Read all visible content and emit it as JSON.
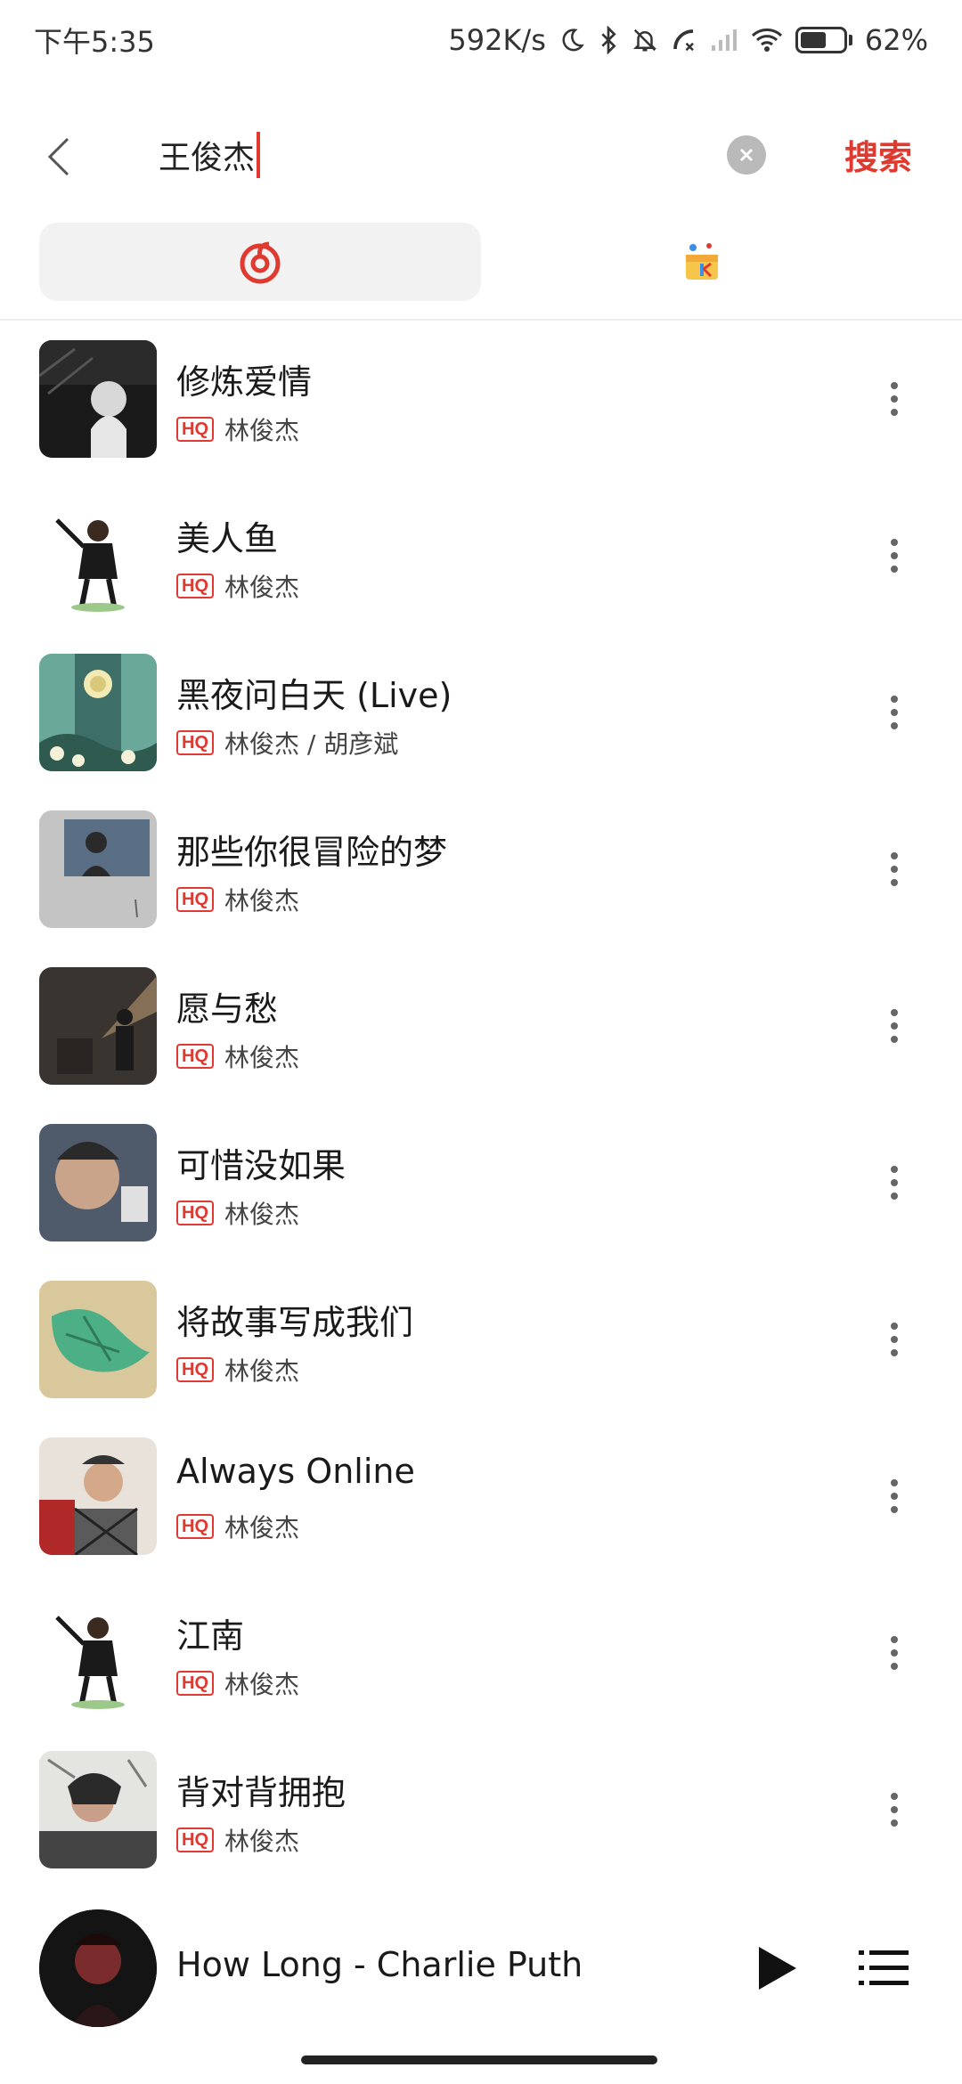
{
  "status_bar": {
    "time": "下午5:35",
    "net_speed": "592K/s",
    "battery": "62%",
    "battery_level": 0.62
  },
  "search": {
    "query": "王俊杰",
    "search_button": "搜索"
  },
  "source_tabs": [
    {
      "name": "netease-music",
      "active": true
    },
    {
      "name": "kge-karaoke",
      "active": false
    }
  ],
  "songs": [
    {
      "title": "修炼爱情",
      "badge": "HQ",
      "artist": "林俊杰"
    },
    {
      "title": "美人鱼",
      "badge": "HQ",
      "artist": "林俊杰"
    },
    {
      "title": "黑夜问白天 (Live)",
      "badge": "HQ",
      "artist": "林俊杰 / 胡彦斌"
    },
    {
      "title": "那些你很冒险的梦",
      "badge": "HQ",
      "artist": "林俊杰"
    },
    {
      "title": "愿与愁",
      "badge": "HQ",
      "artist": "林俊杰"
    },
    {
      "title": "可惜没如果",
      "badge": "HQ",
      "artist": "林俊杰"
    },
    {
      "title": "将故事写成我们",
      "badge": "HQ",
      "artist": "林俊杰"
    },
    {
      "title": "Always Online",
      "badge": "HQ",
      "artist": "林俊杰"
    },
    {
      "title": "江南",
      "badge": "HQ",
      "artist": "林俊杰"
    },
    {
      "title": "背对背拥抱",
      "badge": "HQ",
      "artist": "林俊杰"
    }
  ],
  "player": {
    "now_playing": "How Long - Charlie Puth"
  },
  "colors": {
    "accent": "#e03a30",
    "tab_bg": "#f2f2f2"
  }
}
